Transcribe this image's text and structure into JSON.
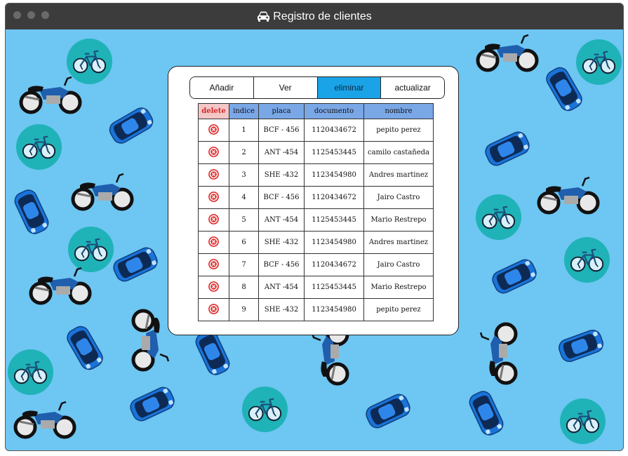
{
  "window": {
    "title": "Registro de clientes",
    "title_icon": "car-icon"
  },
  "toolbar": {
    "buttons": [
      {
        "label": "Añadir",
        "active": false
      },
      {
        "label": "Ver",
        "active": false
      },
      {
        "label": "eliminar",
        "active": true
      },
      {
        "label": "actualizar",
        "active": false
      }
    ]
  },
  "table": {
    "headers": {
      "delete": "delete",
      "indice": "indice",
      "placa": "placa",
      "documento": "documento",
      "nombre": "nombre"
    },
    "rows": [
      {
        "indice": "1",
        "placa": "BCF - 456",
        "documento": "1120434672",
        "nombre": "pepito perez"
      },
      {
        "indice": "2",
        "placa": "ANT -454",
        "documento": "1125453445",
        "nombre": "camilo castañeda"
      },
      {
        "indice": "3",
        "placa": "SHE -432",
        "documento": "1123454980",
        "nombre": "Andres martinez"
      },
      {
        "indice": "4",
        "placa": "BCF - 456",
        "documento": "1120434672",
        "nombre": "Jairo Castro"
      },
      {
        "indice": "5",
        "placa": "ANT -454",
        "documento": "1125453445",
        "nombre": "Mario Restrepo"
      },
      {
        "indice": "6",
        "placa": "SHE -432",
        "documento": "1123454980",
        "nombre": "Andres martinez"
      },
      {
        "indice": "7",
        "placa": "BCF - 456",
        "documento": "1120434672",
        "nombre": "Jairo Castro"
      },
      {
        "indice": "8",
        "placa": "ANT -454",
        "documento": "1125453445",
        "nombre": "Mario Restrepo"
      },
      {
        "indice": "9",
        "placa": "SHE -432",
        "documento": "1123454980",
        "nombre": "pepito perez"
      }
    ]
  },
  "colors": {
    "background": "#6ec6f2",
    "titlebar": "#3c3c3c",
    "active_button": "#1aa3e6",
    "header": "#7aa7e6",
    "delete_header": "#f4c7c7",
    "delete_icon": "#e03030",
    "bike_circle": "#1fb3b8",
    "car": "#1a73d9"
  },
  "background_icons": [
    "bicycle-icon",
    "motorcycle-icon",
    "car-icon"
  ]
}
